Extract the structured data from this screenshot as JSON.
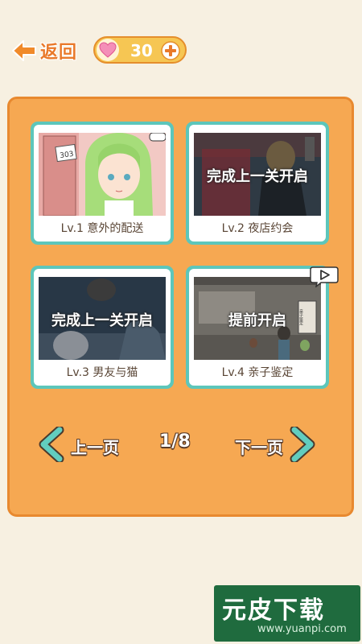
{
  "header": {
    "back_label": "返回",
    "hearts_count": "30"
  },
  "levels": [
    {
      "caption": "Lv.1 意外的配送",
      "overlay": "",
      "door_number": "303"
    },
    {
      "caption": "Lv.2 夜店约会",
      "overlay": "完成上一关开启"
    },
    {
      "caption": "Lv.3 男友与猫",
      "overlay": "完成上一关开启"
    },
    {
      "caption": "Lv.4 亲子鉴定",
      "overlay": "提前开启",
      "sign": "亲子鉴定"
    }
  ],
  "pager": {
    "prev_label": "上一页",
    "next_label": "下一页",
    "indicator": "1/8"
  },
  "watermark": {
    "main": "元皮下载",
    "url": "www.yuanpi.com"
  },
  "colors": {
    "panel": "#f6a852",
    "card_border": "#5dc6bb",
    "accent_orange": "#e9792a"
  }
}
